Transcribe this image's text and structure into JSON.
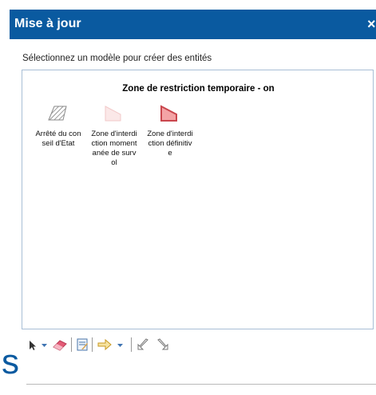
{
  "window": {
    "title": "Mise à jour",
    "close_label": "×"
  },
  "instruction": "Sélectionnez un modèle pour créer des entités",
  "template_group": {
    "title": "Zone de restriction temporaire - on",
    "templates": [
      {
        "label": "Arrêté du conseil d'Etat",
        "icon": "hatched-polygon-icon"
      },
      {
        "label": "Zone d'interdiction momentanée de survol",
        "icon": "light-pink-polygon-icon"
      },
      {
        "label": "Zone d'interdiction définitive",
        "icon": "red-polygon-icon"
      }
    ]
  },
  "toolbar": {
    "items": [
      "select-pointer-icon",
      "dropdown-arrow-icon",
      "eraser-icon",
      "attributes-icon",
      "move-arrow-icon",
      "dropdown-arrow-icon",
      "undo-icon",
      "redo-icon"
    ]
  },
  "partial_text": "s",
  "colors": {
    "titlebar": "#0a5aa0",
    "box_border": "#a9bfd6",
    "definitive_fill": "#f4a3a5",
    "definitive_stroke": "#c9464d"
  }
}
